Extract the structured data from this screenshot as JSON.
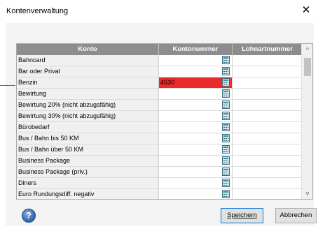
{
  "window": {
    "title": "Kontenverwaltung",
    "close_label": "✕"
  },
  "table": {
    "headers": {
      "konto": "Konto",
      "kontonummer": "Kontonummer",
      "lohnartnummer": "Lohnartnummer"
    },
    "rows": [
      {
        "konto": "Bahncard",
        "kontonummer": "",
        "lohnartnummer": ""
      },
      {
        "konto": "Bar oder Privat",
        "kontonummer": "",
        "lohnartnummer": ""
      },
      {
        "konto": "Benzin",
        "kontonummer": "4530",
        "lohnartnummer": "",
        "highlight": true
      },
      {
        "konto": "Bewirtung",
        "kontonummer": "",
        "lohnartnummer": ""
      },
      {
        "konto": "Bewirtung 20% (nicht abzugsfähig)",
        "kontonummer": "",
        "lohnartnummer": ""
      },
      {
        "konto": "Bewirtung 30% (nicht abzugsfähig)",
        "kontonummer": "",
        "lohnartnummer": ""
      },
      {
        "konto": "Bürobedarf",
        "kontonummer": "",
        "lohnartnummer": ""
      },
      {
        "konto": "Bus / Bahn bis 50 KM",
        "kontonummer": "",
        "lohnartnummer": ""
      },
      {
        "konto": "Bus / Bahn über 50 KM",
        "kontonummer": "",
        "lohnartnummer": ""
      },
      {
        "konto": "Business Package",
        "kontonummer": "",
        "lohnartnummer": ""
      },
      {
        "konto": "Business Package (priv.)",
        "kontonummer": "",
        "lohnartnummer": ""
      },
      {
        "konto": "Diners",
        "kontonummer": "",
        "lohnartnummer": ""
      },
      {
        "konto": "Euro Rundungsdiff. negativ",
        "kontonummer": "",
        "lohnartnummer": ""
      }
    ]
  },
  "scrollbar": {
    "up_glyph": "^",
    "down_glyph": "v"
  },
  "buttons": {
    "help_glyph": "?",
    "save_label": "Speichern",
    "cancel_label": "Abbrechen"
  },
  "colors": {
    "header_bg": "#8d8d8d",
    "error_bg": "#e92b2b",
    "focus_border": "#0078d7"
  }
}
